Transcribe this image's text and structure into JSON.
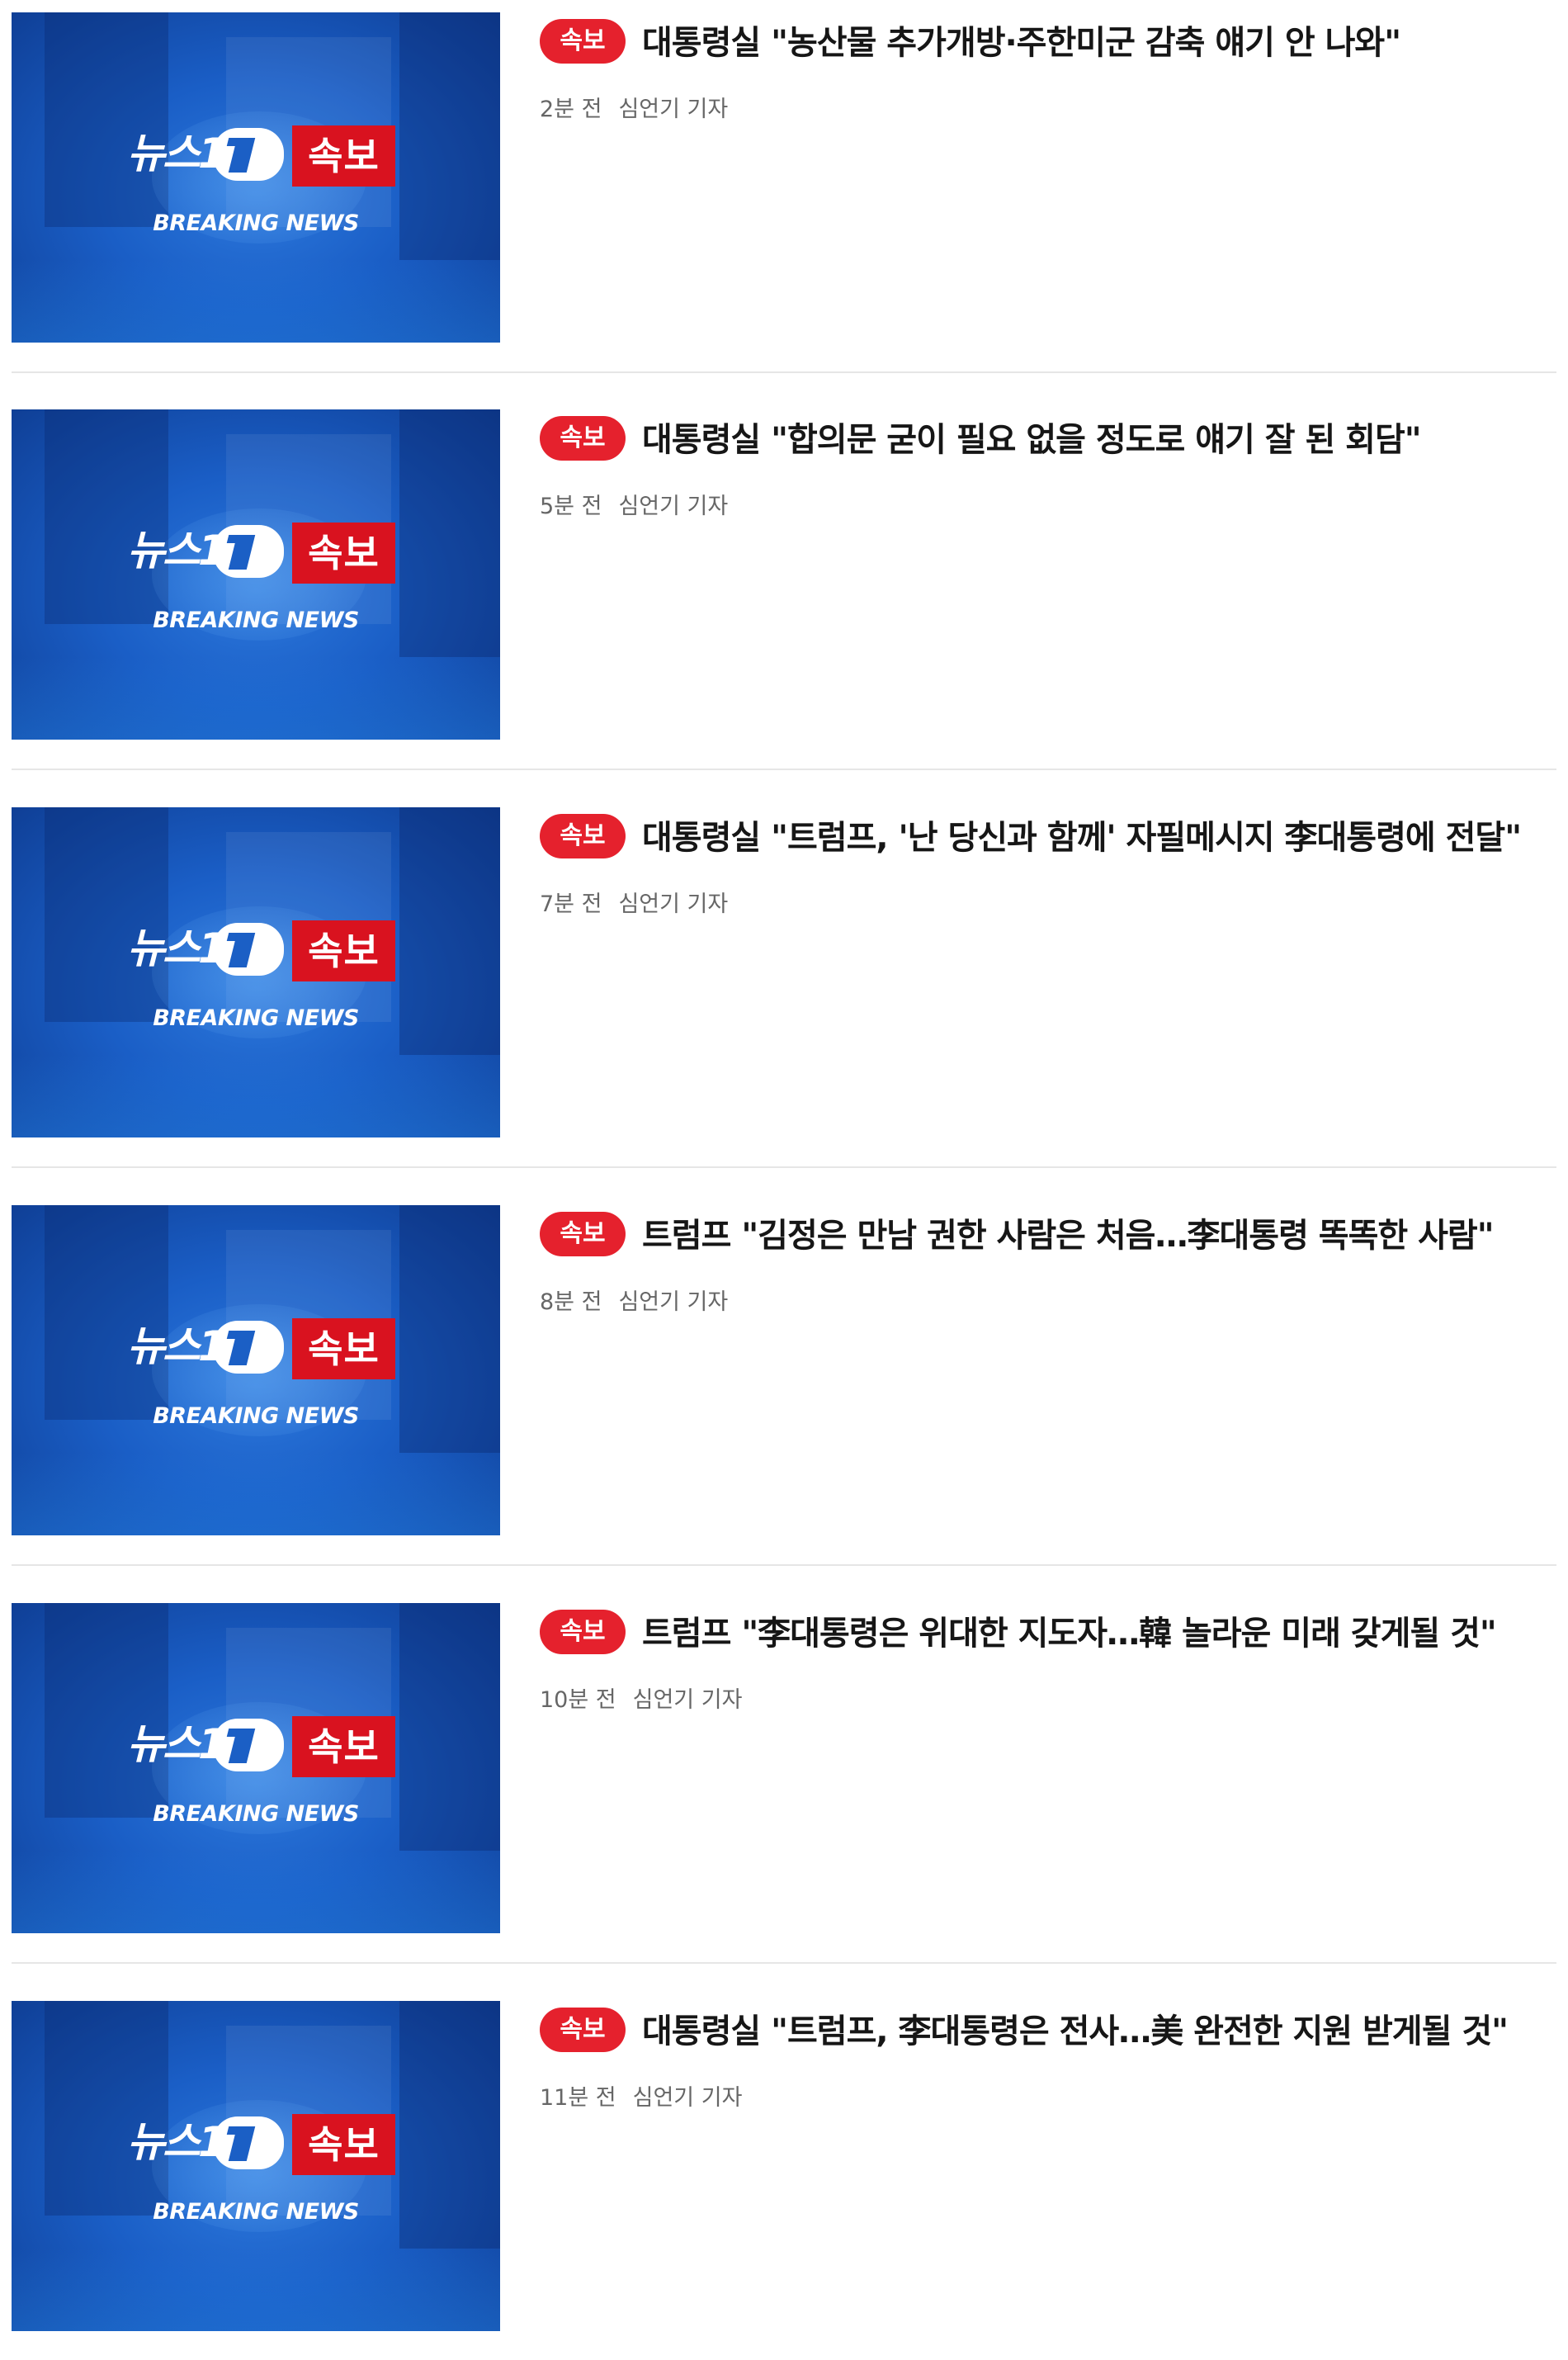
{
  "thumbnail": {
    "logo_text": "뉴스1",
    "logo_badge": "속보",
    "caption": "BREAKING NEWS"
  },
  "articles": [
    {
      "badge": "속보",
      "headline": "대통령실 \"농산물 추가개방·주한미군 감축 얘기 안 나와\"",
      "time": "2분 전",
      "reporter": "심언기 기자"
    },
    {
      "badge": "속보",
      "headline": "대통령실 \"합의문 굳이 필요 없을 정도로 얘기 잘 된 회담\"",
      "time": "5분 전",
      "reporter": "심언기 기자"
    },
    {
      "badge": "속보",
      "headline": "대통령실 \"트럼프, '난 당신과 함께' 자필메시지 李대통령에 전달\"",
      "time": "7분 전",
      "reporter": "심언기 기자"
    },
    {
      "badge": "속보",
      "headline": "트럼프 \"김정은 만남 권한 사람은 처음…李대통령 똑똑한 사람\"",
      "time": "8분 전",
      "reporter": "심언기 기자"
    },
    {
      "badge": "속보",
      "headline": "트럼프 \"李대통령은 위대한 지도자…韓 놀라운 미래 갖게될 것\"",
      "time": "10분 전",
      "reporter": "심언기 기자"
    },
    {
      "badge": "속보",
      "headline": "대통령실 \"트럼프, 李대통령은 전사…美 완전한 지원 받게될 것\"",
      "time": "11분 전",
      "reporter": "심언기 기자"
    }
  ]
}
